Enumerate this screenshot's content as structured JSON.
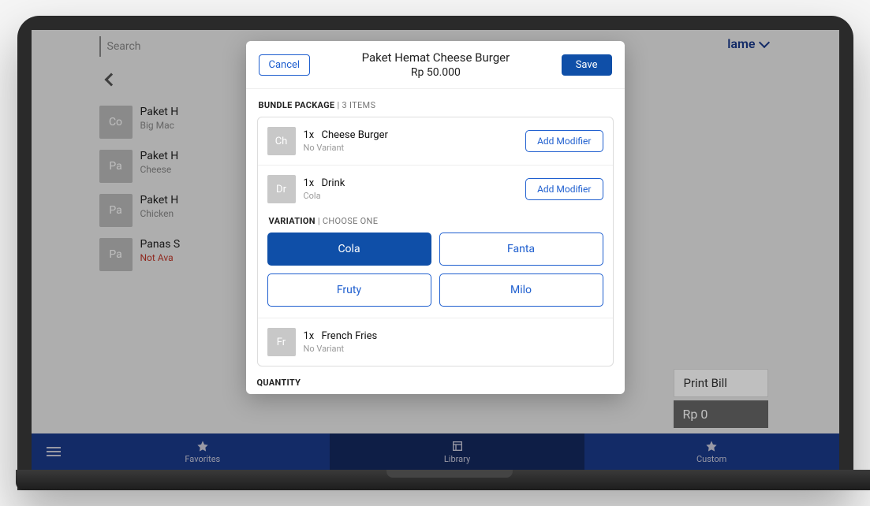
{
  "bg": {
    "searchPlaceholder": "Search",
    "headerRight": "lame",
    "items": [
      {
        "thumb": "Co",
        "name": "Paket H",
        "sub": "Big Mac",
        "subRed": false
      },
      {
        "thumb": "Pa",
        "name": "Paket H",
        "sub": "Cheese",
        "subRed": false
      },
      {
        "thumb": "Pa",
        "name": "Paket H",
        "sub": "Chicken",
        "subRed": false
      },
      {
        "thumb": "Pa",
        "name": "Panas S",
        "sub": "Not Ava",
        "subRed": true
      }
    ],
    "printBill": "Print Bill",
    "rpZero": "Rp 0",
    "nav": {
      "fav": "Favorites",
      "lib": "Library",
      "custom": "Custom"
    }
  },
  "modal": {
    "cancel": "Cancel",
    "save": "Save",
    "title": "Paket Hemat Cheese Burger",
    "price": "Rp 50.000",
    "bundleLabel": "BUNDLE PACKAGE",
    "bundleCount": "3 ITEMS",
    "addModifier": "Add Modifier",
    "items": [
      {
        "thumb": "Ch",
        "qty": "1x",
        "name": "Cheese Burger",
        "sub": "No Variant",
        "hasModifier": true,
        "hasVariation": false
      },
      {
        "thumb": "Dr",
        "qty": "1x",
        "name": "Drink",
        "sub": "Cola",
        "hasModifier": true,
        "hasVariation": true
      },
      {
        "thumb": "Fr",
        "qty": "1x",
        "name": "French Fries",
        "sub": "No Variant",
        "hasModifier": false,
        "hasVariation": false
      }
    ],
    "variationLabel": "VARIATION",
    "variationHint": "CHOOSE ONE",
    "variations": [
      {
        "label": "Cola",
        "selected": true
      },
      {
        "label": "Fanta",
        "selected": false
      },
      {
        "label": "Fruty",
        "selected": false
      },
      {
        "label": "Milo",
        "selected": false
      }
    ],
    "quantityLabel": "QUANTITY"
  }
}
